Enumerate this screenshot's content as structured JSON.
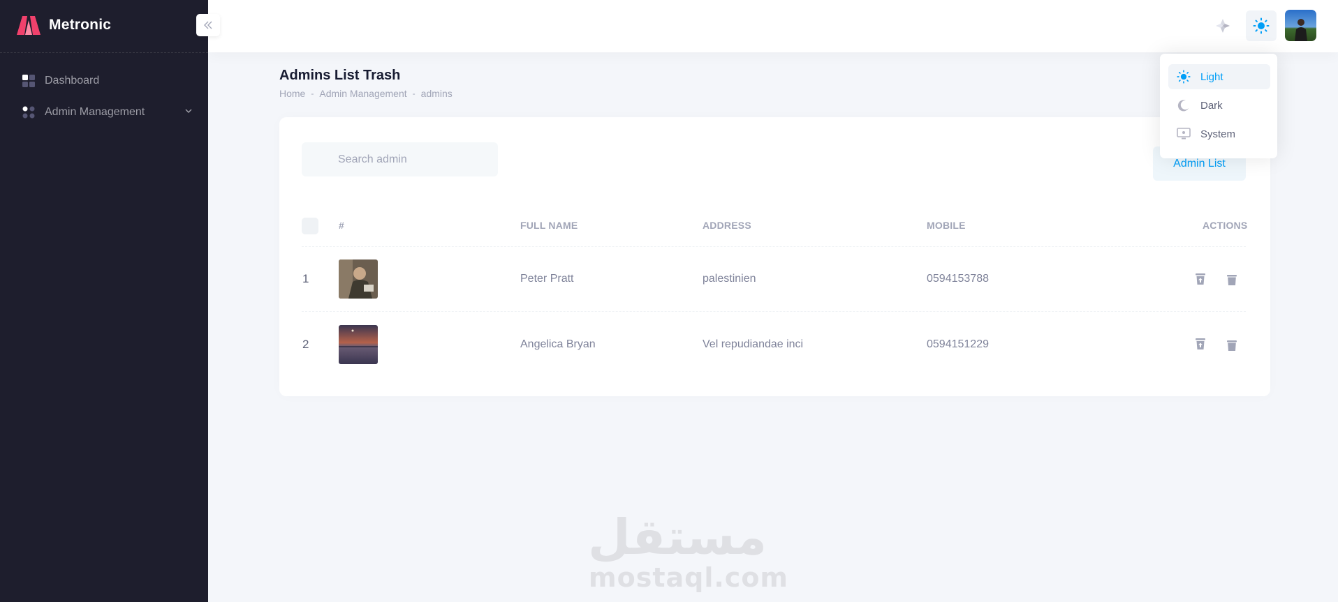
{
  "app": {
    "name": "Metronic"
  },
  "sidebar": {
    "items": [
      {
        "label": "Dashboard",
        "icon": "dashboard-grid-icon"
      },
      {
        "label": "Admin Management",
        "icon": "apps-dots-icon"
      }
    ]
  },
  "header": {
    "icons": [
      "sparkle-icon",
      "sun-icon",
      "user-avatar"
    ]
  },
  "page": {
    "title": "Admins List Trash",
    "breadcrumb": [
      "Home",
      "Admin Management",
      "admins"
    ]
  },
  "toolbar": {
    "search_placeholder": "Search admin",
    "admin_list_button": "Admin List"
  },
  "table": {
    "headers": [
      "#",
      "FULL NAME",
      "ADDRESS",
      "MOBILE",
      "ACTIONS"
    ],
    "rows": [
      {
        "num": "1",
        "full_name": "Peter Pratt",
        "address": "palestinien",
        "mobile": "0594153788"
      },
      {
        "num": "2",
        "full_name": "Angelica Bryan",
        "address": "Vel repudiandae inci",
        "mobile": "0594151229"
      }
    ]
  },
  "theme_menu": {
    "items": [
      {
        "label": "Light",
        "icon": "sun-icon",
        "active": true
      },
      {
        "label": "Dark",
        "icon": "moon-icon",
        "active": false
      },
      {
        "label": "System",
        "icon": "monitor-icon",
        "active": false
      }
    ]
  },
  "watermark": {
    "arabic": "مستقل",
    "latin": "mostaql.com"
  },
  "colors": {
    "primary": "#009ef7",
    "sidebar_bg": "#1e1e2d",
    "page_bg": "#f4f6fa",
    "logo": "#f1416c"
  }
}
